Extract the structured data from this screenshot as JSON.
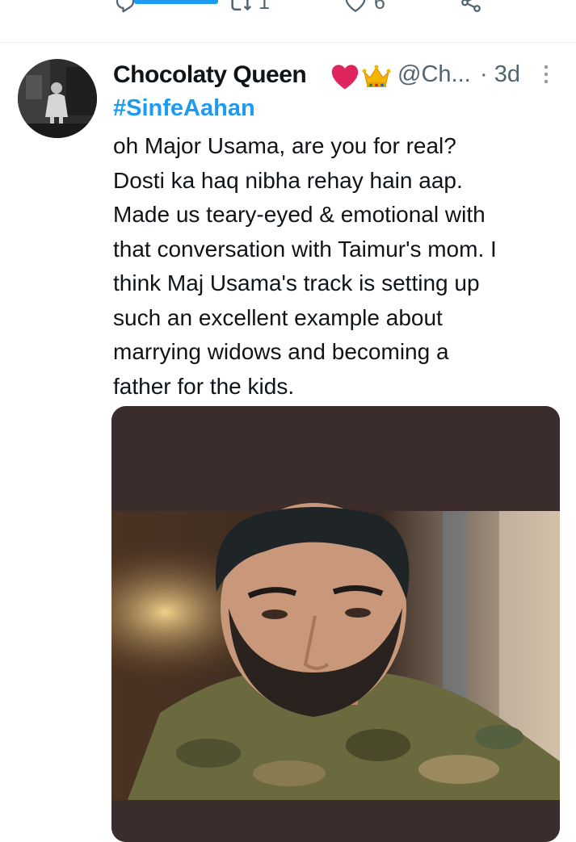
{
  "previous_tweet_actions": {
    "reply": {
      "icon": "reply-icon",
      "count": ""
    },
    "retweet": {
      "icon": "retweet-icon",
      "count": "1"
    },
    "like": {
      "icon": "heart-outline-icon",
      "count": "6"
    },
    "share": {
      "icon": "share-icon"
    }
  },
  "tweet": {
    "author": {
      "name": "Chocolaty Queen",
      "emojis": [
        "red-heart-icon",
        "crown-icon"
      ],
      "handle": "@Ch...",
      "time": "· 3d"
    },
    "hashtag": "#SinfeAahan",
    "text": "oh Major Usama, are you for real?\nDosti ka haq nibha rehay hain aap.\nMade us teary-eyed & emotional with\nthat conversation with Taimur's mom. I\nthink Maj Usama's track is setting up\nsuch an excellent example about\nmarrying widows and becoming a\nfather for the  kids.",
    "media": {
      "type": "photo",
      "description_icon": "tweet-image"
    }
  },
  "colors": {
    "accent": "#1d9bf0",
    "text": "#0f1419",
    "secondary_text": "#536471",
    "heart": "#e0245e"
  }
}
